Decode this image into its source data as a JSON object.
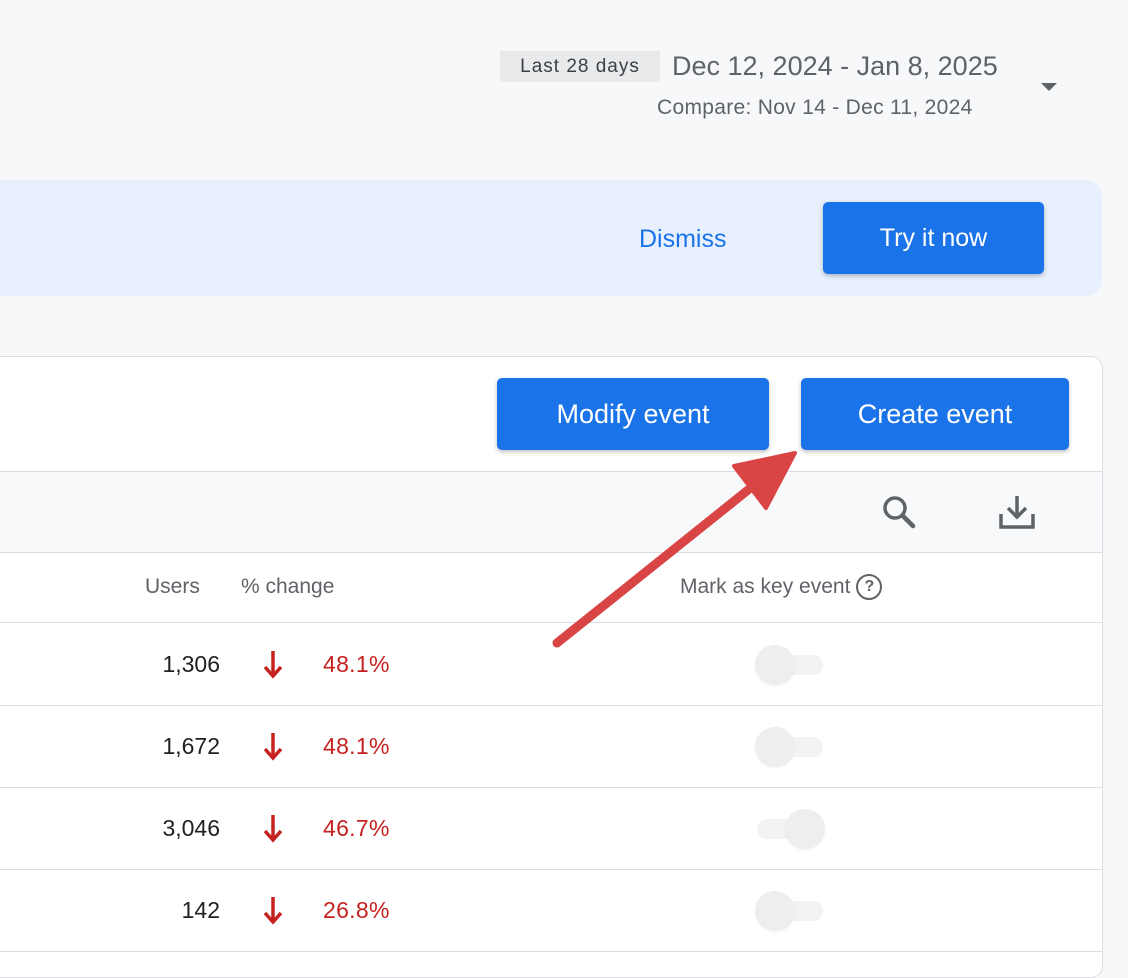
{
  "date_range": {
    "preset_label": "Last 28 days",
    "range_text": "Dec 12, 2024 - Jan 8, 2025",
    "compare_text": "Compare: Nov 14 - Dec 11, 2024",
    "dropdown_icon": "caret-down-icon"
  },
  "banner": {
    "dismiss_label": "Dismiss",
    "try_label": "Try it now"
  },
  "events_card": {
    "modify_label": "Modify event",
    "create_label": "Create event",
    "toolbar_icons": [
      "search-icon",
      "download-icon"
    ],
    "columns": {
      "users": "Users",
      "change": "% change",
      "key_event": "Mark as key event",
      "help_icon_glyph": "?"
    },
    "rows": [
      {
        "users": "1,306",
        "change": "48.1%",
        "key_event_on": false
      },
      {
        "users": "1,672",
        "change": "48.1%",
        "key_event_on": false
      },
      {
        "users": "3,046",
        "change": "46.7%",
        "key_event_on": true
      },
      {
        "users": "142",
        "change": "26.8%",
        "key_event_on": false
      }
    ]
  },
  "colors": {
    "accent_blue": "#1a73e8",
    "negative_red": "#c5221f",
    "annotation_red": "#d94545",
    "banner_bg": "#e8f0fe"
  }
}
